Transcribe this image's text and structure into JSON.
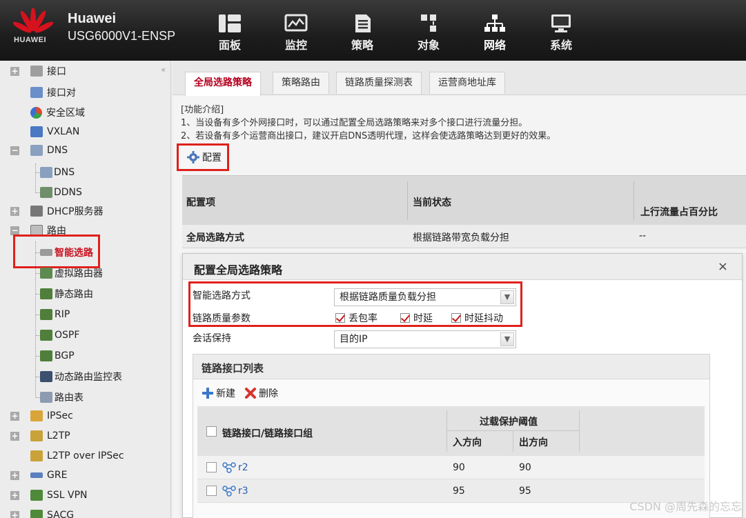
{
  "header": {
    "brand": "Huawei",
    "model": "USG6000V1-ENSP",
    "logo_text": "HUAWEI",
    "nav": [
      {
        "label": "面板",
        "icon": "dashboard-icon"
      },
      {
        "label": "监控",
        "icon": "monitor-icon"
      },
      {
        "label": "策略",
        "icon": "policy-icon"
      },
      {
        "label": "对象",
        "icon": "object-icon"
      },
      {
        "label": "网络",
        "icon": "network-icon",
        "active": true
      },
      {
        "label": "系统",
        "icon": "system-icon"
      }
    ]
  },
  "sidebar": {
    "items": [
      {
        "label": "接口"
      },
      {
        "label": "接口对"
      },
      {
        "label": "安全区域"
      },
      {
        "label": "VXLAN"
      },
      {
        "label": "DNS"
      },
      {
        "label": "DNS"
      },
      {
        "label": "DDNS"
      },
      {
        "label": "DHCP服务器"
      },
      {
        "label": "路由"
      },
      {
        "label": "智能选路",
        "selected": true
      },
      {
        "label": "虚拟路由器"
      },
      {
        "label": "静态路由"
      },
      {
        "label": "RIP"
      },
      {
        "label": "OSPF"
      },
      {
        "label": "BGP"
      },
      {
        "label": "动态路由监控表"
      },
      {
        "label": "路由表"
      },
      {
        "label": "IPSec"
      },
      {
        "label": "L2TP"
      },
      {
        "label": "L2TP over IPSec"
      },
      {
        "label": "GRE"
      },
      {
        "label": "SSL VPN"
      },
      {
        "label": "SACG"
      }
    ]
  },
  "tabs": [
    "全局选路策略",
    "策略路由",
    "链路质量探测表",
    "运营商地址库"
  ],
  "intro": {
    "title": "[功能介绍]",
    "line1": "1、当设备有多个外网接口时，可以通过配置全局选路策略来对多个接口进行流量分担。",
    "line2": "2、若设备有多个运营商出接口，建议开启DNS透明代理，这样会使选路策略达到更好的效果。"
  },
  "config_button": "配置",
  "grid": {
    "headers": [
      "配置项",
      "当前状态",
      "上行流量占百分比"
    ],
    "row": [
      "全局选路方式",
      "根据链路带宽负载分担",
      "--"
    ]
  },
  "dialog": {
    "title": "配置全局选路策略",
    "close": "×",
    "mode_label": "智能选路方式",
    "mode_value": "根据链路质量负载分担",
    "quality_label": "链路质量参数",
    "quality_options": [
      "丢包率",
      "时延",
      "时延抖动"
    ],
    "session_label": "会话保持",
    "session_value": "目的IP",
    "link_panel": {
      "title": "链路接口列表",
      "new_btn": "新建",
      "delete_btn": "删除",
      "col_name": "链路接口/链路接口组",
      "col_overload": "过载保护阈值",
      "col_in": "入方向",
      "col_out": "出方向",
      "rows": [
        {
          "name": "r2",
          "in": "90",
          "out": "90"
        },
        {
          "name": "r3",
          "in": "95",
          "out": "95"
        }
      ]
    }
  },
  "watermark": "CSDN @周先森的忘忘",
  "colors": {
    "accent": "#b4001e",
    "highlight": "#e0201b",
    "link": "#2a5db0"
  }
}
